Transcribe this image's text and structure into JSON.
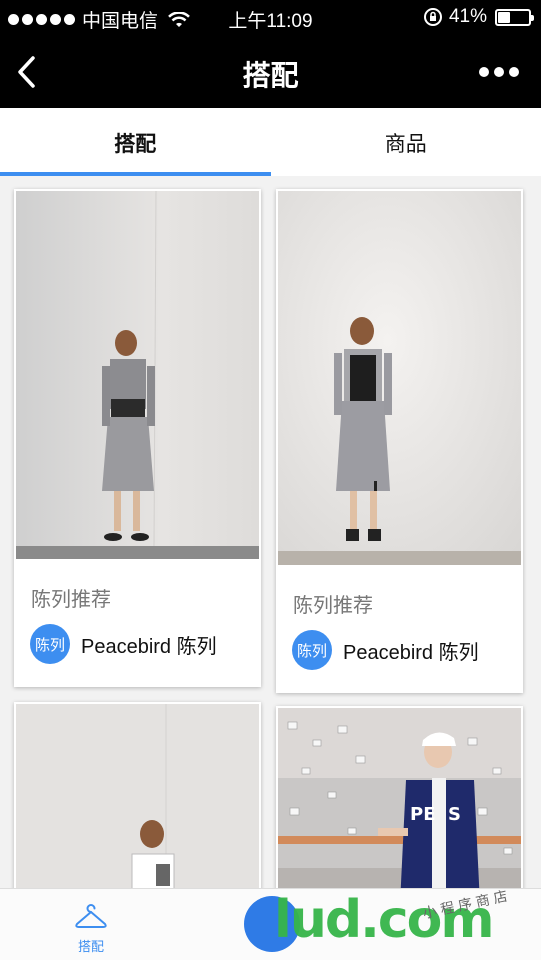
{
  "status_bar": {
    "carrier": "中国电信",
    "time": "上午11:09",
    "battery": "41%",
    "battery_level": 0.41
  },
  "nav": {
    "title": "搭配"
  },
  "tabs": [
    {
      "label": "搭配",
      "active": true
    },
    {
      "label": "商品",
      "active": false
    }
  ],
  "cards": [
    {
      "label": "陈列推荐",
      "badge": "陈列",
      "brand": "Peacebird 陈列"
    },
    {
      "label": "陈列推荐",
      "badge": "陈列",
      "brand": "Peacebird 陈列"
    }
  ],
  "bottom_tab": {
    "label": "搭配"
  },
  "watermark": {
    "brand": "lud.com",
    "tagline": "小程序商店"
  },
  "colors": {
    "accent": "#3d8ef0",
    "bar": "#000000",
    "watermark_green": "#37b54a",
    "watermark_orange": "#f0a030"
  }
}
